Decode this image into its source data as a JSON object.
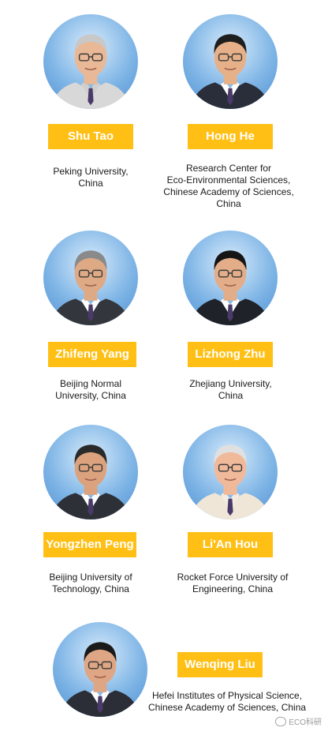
{
  "people": [
    {
      "name": "Shu Tao",
      "affiliation": "Peking University,\nChina",
      "hair": "#c8c8c8",
      "suit": "#d8d8d8",
      "shirt": "#cfcfcf",
      "skin": "#e9b896"
    },
    {
      "name": "Hong He",
      "affiliation": "Research Center for\nEco-Environmental Sciences,\nChinese Academy of Sciences,\nChina",
      "hair": "#1e1e1e",
      "suit": "#2a2e3a",
      "shirt": "#ffffff",
      "skin": "#e6b089"
    },
    {
      "name": "Zhifeng Yang",
      "affiliation": "Beijing Normal\nUniversity, China",
      "hair": "#8a8a8a",
      "suit": "#33363d",
      "shirt": "#ffffff",
      "skin": "#deaa86"
    },
    {
      "name": "Lizhong Zhu",
      "affiliation": "Zhejiang University,\nChina",
      "hair": "#151515",
      "suit": "#1f2229",
      "shirt": "#ffffff",
      "skin": "#e2ad88"
    },
    {
      "name": "Yongzhen Peng",
      "affiliation": "Beijing University of\nTechnology, China",
      "hair": "#2a2a2a",
      "suit": "#2e3038",
      "shirt": "#ffffff",
      "skin": "#dba27d"
    },
    {
      "name": "Li'An Hou",
      "affiliation": "Rocket Force University of\nEngineering, China",
      "hair": "#e0e0e0",
      "suit": "#efe6d8",
      "shirt": "#f3ece2",
      "skin": "#f0b99a"
    },
    {
      "name": "Wenqing Liu",
      "affiliation": "Hefei Institutes of Physical Science,\nChinese Academy of Sciences, China",
      "hair": "#1a1a1a",
      "suit": "#2b2e36",
      "shirt": "#ffffff",
      "skin": "#dea684"
    }
  ],
  "watermark": {
    "text": "ECO科研",
    "icon": "wechat-icon"
  },
  "colors": {
    "name_tag": "#ffbf14",
    "name_text": "#ffffff"
  }
}
